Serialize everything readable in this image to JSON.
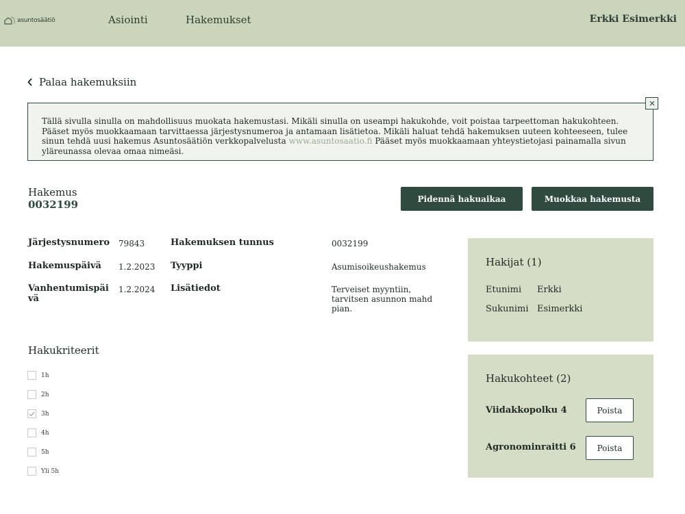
{
  "header": {
    "logo_text": "asuntosäätiö",
    "nav": [
      "Asiointi",
      "Hakemukset"
    ],
    "user_name": "Erkki Esimerkki"
  },
  "back_link": {
    "label": "Palaa hakemuksiin",
    "icon": "chevron-left-icon"
  },
  "info": {
    "text_before_link": "Tällä sivulla sinulla on mahdollisuus muokata hakemustasi. Mikäli sinulla on useampi hakukohde, voit poistaa tarpeettoman hakukohteen. Pääset myös muokkaamaan tarvittaessa järjestysnumeroa ja antamaan lisätietoa. Mikäli haluat tehdä hakemuksen uuteen kohteeseen, tulee sinun tehdä uusi hakemus Asuntosäätiön verkkopalvelusta ",
    "link_text": "www.asuntosaatio.fi",
    "text_after_link": " Pääset myös muokkaamaan yhteystietojasi painamalla sivun yläreunassa olevaa omaa nimeäsi.",
    "close_icon": "close-icon"
  },
  "application": {
    "label": "Hakemus",
    "number": "0032199"
  },
  "actions": {
    "extend_label": "Pidennä hakuaikaa",
    "edit_label": "Muokkaa hakemusta"
  },
  "details": {
    "order_number_label": "Järjestysnumero",
    "order_number_value": "79843",
    "application_id_label": "Hakemuksen tunnus",
    "application_id_value": "0032199",
    "date_label": "Hakemuspäivä",
    "date_value": "1.2.2023",
    "type_label": "Tyyppi",
    "type_value": "Asumisoikeushakemus",
    "expiry_label": "Vanhentumispäivä",
    "expiry_value": "1.2.2024",
    "extra_label": "Lisätiedot",
    "extra_value": "Terveiset myyntiin, tarvitsen asunnon mahd pian."
  },
  "criteria": {
    "title": "Hakukriteerit",
    "items": [
      {
        "label": "1h",
        "checked": false
      },
      {
        "label": "2h",
        "checked": false
      },
      {
        "label": "3h",
        "checked": true
      },
      {
        "label": "4h",
        "checked": false
      },
      {
        "label": "5h",
        "checked": false
      },
      {
        "label": "Yli 5h",
        "checked": false
      }
    ]
  },
  "applicants": {
    "title": "Hakijat (1)",
    "first_name_label": "Etunimi",
    "first_name_value": "Erkki",
    "last_name_label": "Sukunimi",
    "last_name_value": "Esimerkki"
  },
  "targets": {
    "title": "Hakukohteet (2)",
    "items": [
      {
        "name": "Viidakkopolku 4",
        "remove_label": "Poista"
      },
      {
        "name": "Agronominraitti 6",
        "remove_label": "Poista"
      }
    ]
  },
  "colors": {
    "header_bg": "#cbd5bb",
    "primary_dark": "#2f4a3f",
    "panel_bg": "#d5ddc7",
    "link": "#9aaa8e"
  }
}
